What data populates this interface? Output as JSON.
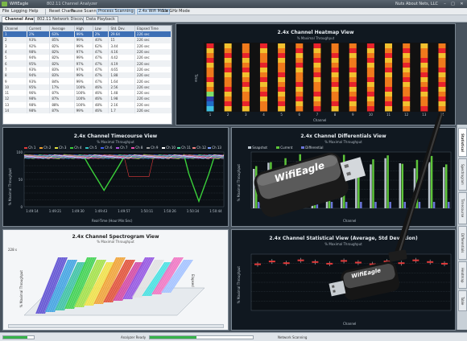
{
  "window": {
    "title": "WifiEagle",
    "subtitle": "802.11 Channel Analyzer",
    "company": "Nuts About Nets, LLC",
    "min": "–",
    "max": "□",
    "close": "✕"
  },
  "menu": {
    "file": "File",
    "logging": "Logging",
    "help": "Help",
    "reset": "Reset Charts",
    "pause": "Pause Scanning",
    "process": "Process Scanning",
    "mode1": "2.4x Wifi Mode",
    "mode2": "5.x GHz Mode"
  },
  "tabs": [
    "Channel Analysis",
    "802.11 Network Discovery",
    "Data Playback"
  ],
  "table": {
    "columns": [
      "Channel",
      "Current",
      "Average",
      "High",
      "Low",
      "Std. Dev.",
      "Elapsed Time"
    ],
    "rows": [
      [
        "1",
        "2%",
        "63%",
        "99%",
        "2%",
        "29.64",
        "226 sec"
      ],
      [
        "2",
        "93%",
        "85%",
        "99%",
        "40%",
        "15",
        "226 sec"
      ],
      [
        "3",
        "92%",
        "82%",
        "99%",
        "62%",
        "3.44",
        "226 sec"
      ],
      [
        "4",
        "98%",
        "82%",
        "97%",
        "47%",
        "4.16",
        "226 sec"
      ],
      [
        "5",
        "94%",
        "82%",
        "99%",
        "47%",
        "4.42",
        "226 sec"
      ],
      [
        "6",
        "95%",
        "82%",
        "97%",
        "47%",
        "4.19",
        "226 sec"
      ],
      [
        "7",
        "93%",
        "83%",
        "97%",
        "47%",
        "4.65",
        "226 sec"
      ],
      [
        "8",
        "94%",
        "83%",
        "99%",
        "47%",
        "1.88",
        "226 sec"
      ],
      [
        "9",
        "93%",
        "84%",
        "99%",
        "47%",
        "1.64",
        "226 sec"
      ],
      [
        "10",
        "95%",
        "17%",
        "100%",
        "46%",
        "2.56",
        "226 sec"
      ],
      [
        "11",
        "96%",
        "87%",
        "100%",
        "46%",
        "1.48",
        "226 sec"
      ],
      [
        "12",
        "98%",
        "87%",
        "100%",
        "46%",
        "1.98",
        "226 sec"
      ],
      [
        "13",
        "98%",
        "88%",
        "100%",
        "48%",
        "2.16",
        "226 sec"
      ],
      [
        "14",
        "98%",
        "87%",
        "99%",
        "46%",
        "1.7",
        "226 sec"
      ]
    ]
  },
  "heatmap": {
    "title": "2.4x Channel Heatmap View",
    "subtitle": "% Maximal Throughput",
    "xlabel": "Channel",
    "ylabel": "Time",
    "channels": [
      "1",
      "2",
      "3",
      "4",
      "5",
      "6",
      "7",
      "8",
      "9",
      "10",
      "11",
      "12",
      "13",
      "14"
    ]
  },
  "timecourse": {
    "title": "2.4x Channel Timecourse View",
    "subtitle": "% Maximal Throughput",
    "xlabel": "Real-Time (Hour:Min:Sec)",
    "ylabel": "% Maximal Throughput",
    "legend": [
      "Ch 1",
      "Ch 2",
      "Ch 3",
      "Ch 4",
      "Ch 5",
      "Ch 6",
      "Ch 7",
      "Ch 8",
      "Ch 9",
      "Ch 10",
      "Ch 11",
      "Ch 12",
      "Ch 13"
    ],
    "times": [
      "1:49:14",
      "1:49:21",
      "1:49:30",
      "1:49:43",
      "1:49:57",
      "1:50:11",
      "1:50:26",
      "1:50:34",
      "1:50:44"
    ]
  },
  "differentials": {
    "title": "2.4x Channel Differentials View",
    "subtitle": "% Maximal Throughput",
    "xlabel": "Channel",
    "ylabel": "% Maximal Throughput",
    "legend": [
      "Snapshot",
      "Current",
      "Differential"
    ]
  },
  "spectrogram": {
    "title": "2.4x Channel Spectrogram View",
    "subtitle": "% Maximal Throughput",
    "ylabel": "% Maximal Throughput",
    "zlabel": "Elapsed",
    "tick": "228 s"
  },
  "statistical": {
    "title": "2.4x Channel Statistical View (Average, Std Deviation)",
    "subtitle": "% Maximal Throughput",
    "xlabel": "Channel",
    "ylabel": "% Maximal Throughput"
  },
  "sidetabs": [
    "Statistical",
    "Spectrogram",
    "Timecourse",
    "Differentials",
    "Heatmap",
    "Table"
  ],
  "status": {
    "ready": "Analyzer Ready",
    "network": "Network Scanning",
    "progress1": 0.78,
    "progress2": 0.45
  },
  "brand": "WifiEagle",
  "colors": {
    "accent": "#3d6fb5",
    "green": "#37b34a"
  }
}
